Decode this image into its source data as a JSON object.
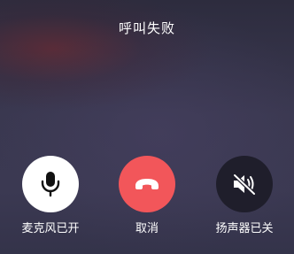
{
  "call": {
    "status": "呼叫失败"
  },
  "controls": {
    "mic": {
      "label": "麦克风已开",
      "icon": "microphone-icon",
      "color": "#ffffff"
    },
    "cancel": {
      "label": "取消",
      "icon": "hang-up-icon",
      "color": "#f2565a"
    },
    "speaker": {
      "label": "扬声器已关",
      "icon": "speaker-muted-icon",
      "color": "#1f1e2b"
    }
  }
}
